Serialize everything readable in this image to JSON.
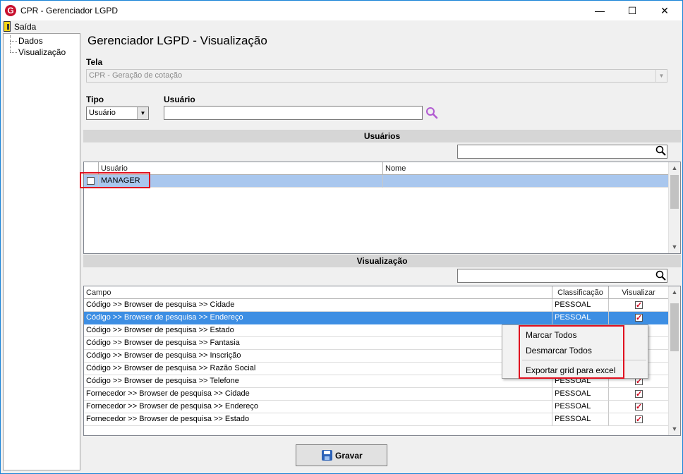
{
  "window": {
    "title": "CPR - Gerenciador LGPD",
    "app_icon_letter": "G",
    "minimize_glyph": "—",
    "maximize_glyph": "☐",
    "close_glyph": "✕"
  },
  "menu": {
    "exit_label": "Saída"
  },
  "tree": {
    "items": [
      "Dados",
      "Visualização"
    ]
  },
  "page_title": "Gerenciador LGPD - Visualização",
  "tela": {
    "label": "Tela",
    "value": "CPR - Geração de cotação"
  },
  "tipo": {
    "label": "Tipo",
    "value": "Usuário"
  },
  "usuario": {
    "label": "Usuário",
    "value": ""
  },
  "usuarios_section": {
    "title": "Usuários",
    "search_value": "",
    "columns": [
      "Usuário",
      "Nome"
    ],
    "rows": [
      {
        "usuario": "MANAGER",
        "nome": "",
        "checked": false
      }
    ]
  },
  "visualizacao_section": {
    "title": "Visualização",
    "search_value": "",
    "columns": [
      "Campo",
      "Classificação",
      "Visualizar"
    ],
    "rows": [
      {
        "campo": "Código >> Browser de pesquisa >> Cidade",
        "classificacao": "PESSOAL",
        "visualizar": true
      },
      {
        "campo": "Código >> Browser de pesquisa >> Endereço",
        "classificacao": "PESSOAL",
        "visualizar": true
      },
      {
        "campo": "Código >> Browser de pesquisa >> Estado",
        "classificacao": "PESSOAL",
        "visualizar": true
      },
      {
        "campo": "Código >> Browser de pesquisa >> Fantasia",
        "classificacao": "PESSOAL",
        "visualizar": true
      },
      {
        "campo": "Código >> Browser de pesquisa >> Inscrição",
        "classificacao": "PESSOAL",
        "visualizar": true
      },
      {
        "campo": "Código >> Browser de pesquisa >> Razão Social",
        "classificacao": "PESSOAL",
        "visualizar": true
      },
      {
        "campo": "Código >> Browser de pesquisa >> Telefone",
        "classificacao": "PESSOAL",
        "visualizar": true
      },
      {
        "campo": "Fornecedor >> Browser de pesquisa >> Cidade",
        "classificacao": "PESSOAL",
        "visualizar": true
      },
      {
        "campo": "Fornecedor >> Browser de pesquisa >> Endereço",
        "classificacao": "PESSOAL",
        "visualizar": true
      },
      {
        "campo": "Fornecedor >> Browser de pesquisa >> Estado",
        "classificacao": "PESSOAL",
        "visualizar": true
      }
    ]
  },
  "context_menu": {
    "items": [
      "Marcar Todos",
      "Desmarcar Todos",
      "Exportar grid para excel"
    ]
  },
  "save_button": {
    "label": "Gravar"
  },
  "colors": {
    "selection": "#3d8ee3",
    "highlight": "#e0101f",
    "check": "#d0021b"
  },
  "icons": [
    "app-logo-icon",
    "exit-door-icon",
    "search-icon",
    "magnifier-icon",
    "save-disk-icon"
  ]
}
